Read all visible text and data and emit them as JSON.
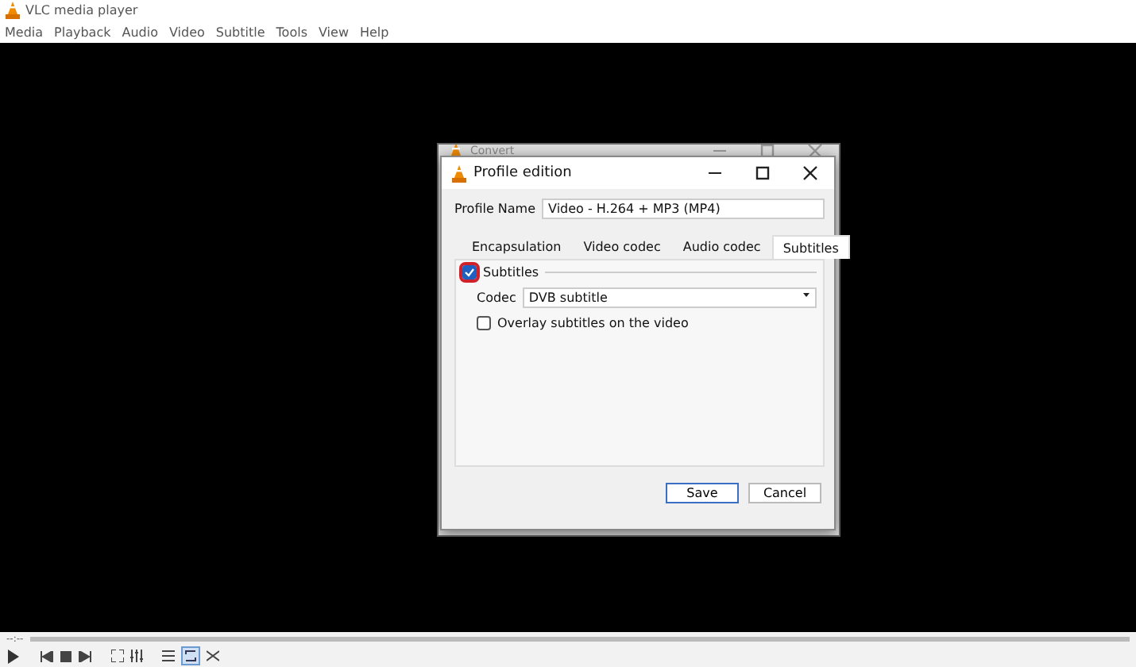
{
  "window": {
    "title": "VLC media player"
  },
  "menu": [
    "Media",
    "Playback",
    "Audio",
    "Video",
    "Subtitle",
    "Tools",
    "View",
    "Help"
  ],
  "background_window": {
    "title": "Convert"
  },
  "dialog": {
    "title": "Profile edition",
    "profile_name_label": "Profile Name",
    "profile_name": "Video - H.264 + MP3 (MP4)",
    "tabs": [
      {
        "label": "Encapsulation",
        "selected": false
      },
      {
        "label": "Video codec",
        "selected": false
      },
      {
        "label": "Audio codec",
        "selected": false
      },
      {
        "label": "Subtitles",
        "selected": true
      }
    ],
    "subtitles": {
      "label": "Subtitles",
      "checked": true
    },
    "codec_label": "Codec",
    "codec": "DVB subtitle",
    "overlay": {
      "label": "Overlay subtitles on the video",
      "checked": false
    },
    "buttons": [
      "Save",
      "Cancel"
    ]
  },
  "player": {
    "time": "--:--"
  }
}
